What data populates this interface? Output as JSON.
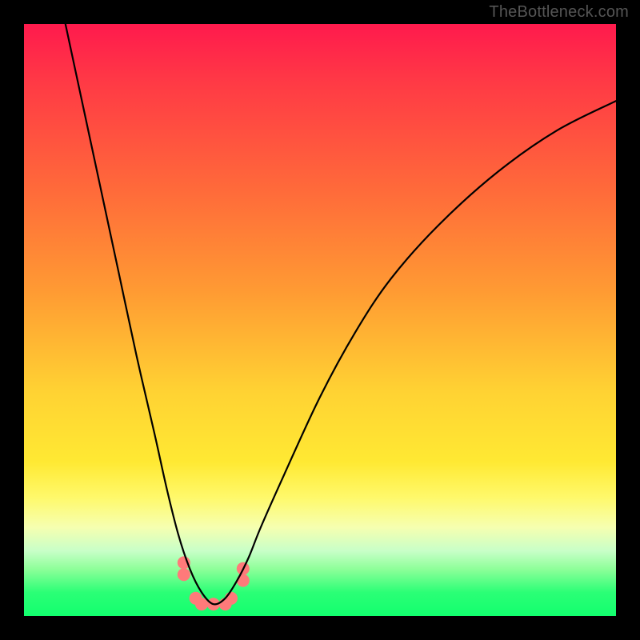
{
  "watermark": "TheBottleneck.com",
  "chart_data": {
    "type": "line",
    "title": "",
    "xlabel": "",
    "ylabel": "",
    "xlim": [
      0,
      100
    ],
    "ylim": [
      0,
      100
    ],
    "grid": false,
    "legend": false,
    "notes": "V-shaped bottleneck curve on a red→green vertical gradient background. Axes and ticks are not labeled in the image; x and y are inferred as 0–100. Curve drops from top-left, reaches a minimum near x≈32 where a cluster of pink dots sits at the trough, then rises toward the upper right.",
    "series": [
      {
        "name": "curve",
        "color": "#000000",
        "x": [
          7,
          10,
          13,
          16,
          19,
          22,
          24,
          26,
          28,
          30,
          32,
          34,
          36,
          38,
          40,
          44,
          50,
          56,
          62,
          70,
          80,
          90,
          100
        ],
        "y": [
          100,
          86,
          72,
          58,
          44,
          31,
          22,
          14,
          8,
          4,
          2,
          3,
          6,
          10,
          15,
          24,
          37,
          48,
          57,
          66,
          75,
          82,
          87
        ]
      }
    ],
    "markers": [
      {
        "name": "trough-dots",
        "color": "#ff7a7a",
        "shape": "circle",
        "radius_px": 8,
        "points": [
          {
            "x": 27,
            "y": 9
          },
          {
            "x": 27,
            "y": 7
          },
          {
            "x": 29,
            "y": 3
          },
          {
            "x": 30,
            "y": 2
          },
          {
            "x": 32,
            "y": 2
          },
          {
            "x": 34,
            "y": 2
          },
          {
            "x": 35,
            "y": 3
          },
          {
            "x": 37,
            "y": 6
          },
          {
            "x": 37,
            "y": 8
          }
        ]
      }
    ],
    "background_gradient": {
      "direction": "vertical",
      "stops": [
        {
          "pos": 0.0,
          "color": "#ff1a4d"
        },
        {
          "pos": 0.45,
          "color": "#ff9a33"
        },
        {
          "pos": 0.74,
          "color": "#ffe933"
        },
        {
          "pos": 0.89,
          "color": "#c8ffc8"
        },
        {
          "pos": 1.0,
          "color": "#12ff6e"
        }
      ]
    }
  }
}
